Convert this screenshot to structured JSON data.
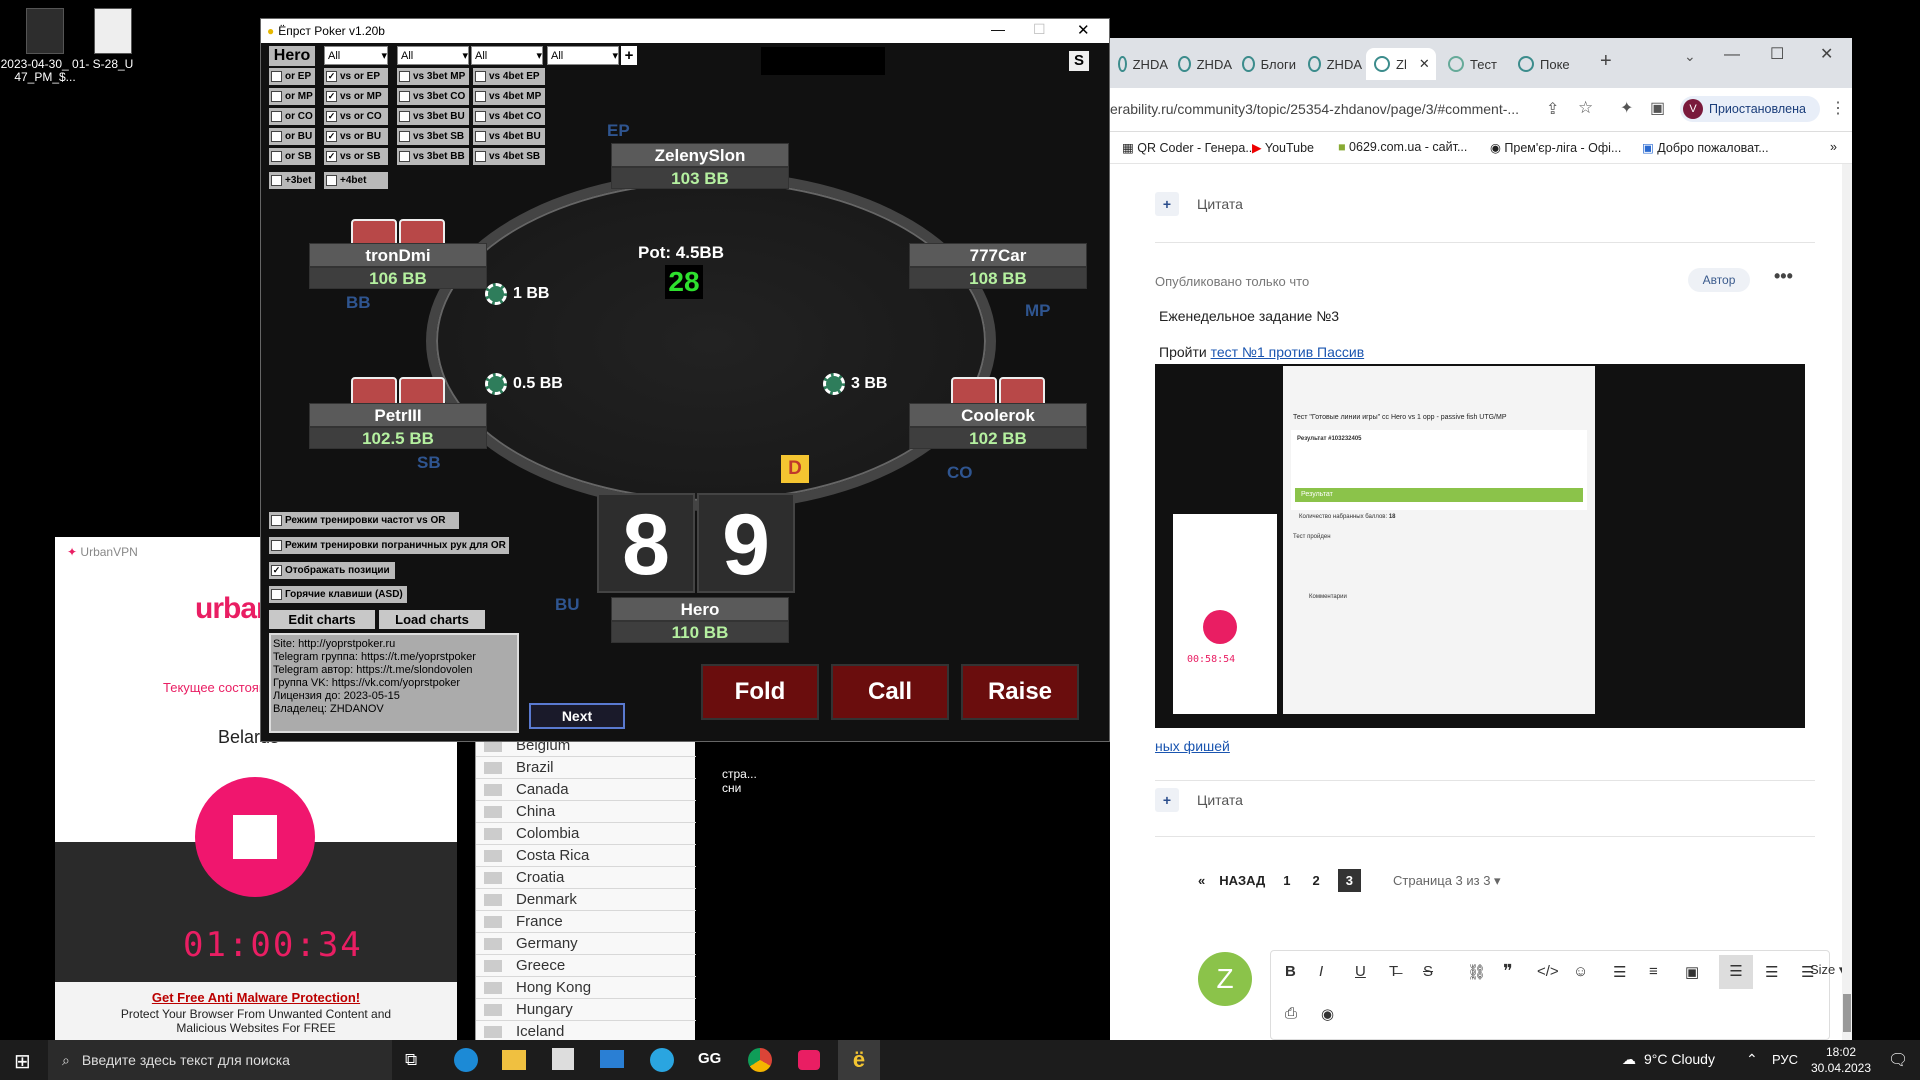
{
  "desktop": {
    "icons": [
      {
        "label": "2023-04-30_ 01-47_PM_$..."
      },
      {
        "label": "S-28_U"
      }
    ],
    "mid_text": "стра...\nсни"
  },
  "poker": {
    "title": "Ёпрст Poker v1.20b",
    "hero_label": "Hero",
    "selects": [
      "All",
      "All",
      "All",
      "All"
    ],
    "add_label": "+",
    "s_label": "S",
    "col1": [
      "or EP",
      "or MP",
      "or CO",
      "or BU",
      "or SB"
    ],
    "col2": [
      "vs or EP",
      "vs or MP",
      "vs or CO",
      "vs or BU",
      "vs or SB"
    ],
    "col3": [
      "vs 3bet MP",
      "vs 3bet CO",
      "vs 3bet BU",
      "vs 3bet SB",
      "vs 3bet BB"
    ],
    "col4": [
      "vs 4bet EP",
      "vs 4bet MP",
      "vs 4bet CO",
      "vs 4bet BU",
      "vs 4bet SB"
    ],
    "extra": [
      "+3bet",
      "+4bet"
    ],
    "seats": {
      "ep": {
        "name": "ZelenySlon",
        "stack": "103 BB",
        "pos": "EP"
      },
      "bb": {
        "name": "tronDmi",
        "stack": "106 BB",
        "pos": "BB"
      },
      "mp": {
        "name": "777Car",
        "stack": "108 BB",
        "pos": "MP"
      },
      "sb": {
        "name": "PetrIII",
        "stack": "102.5 BB",
        "pos": "SB"
      },
      "co": {
        "name": "Coolerok",
        "stack": "102 BB",
        "pos": "CO"
      },
      "hero": {
        "name": "Hero",
        "stack": "110 BB",
        "pos": "BU"
      }
    },
    "pot": "Pot: 4.5BB",
    "timer": "28",
    "bets": {
      "bb": "1 BB",
      "sb": "0.5 BB",
      "co": "3 BB"
    },
    "dealer": "D",
    "hero_cards": [
      "8",
      "9"
    ],
    "options": [
      "Режим тренировки частот vs OR",
      "Режим тренировки пограничных рук для OR",
      "Отображать позиции",
      "Горячие клавиши (ASD)"
    ],
    "edit_charts": "Edit charts",
    "load_charts": "Load charts",
    "info_lines": [
      "Site: http://yoprstpoker.ru",
      "Telegram группа: https://t.me/yoprstpoker",
      "Telegram автор: https://t.me/slondovolen",
      "Группа VK: https://vk.com/yoprstpoker",
      "Лицензия до: 2023-05-15",
      "Владелец: ZHDANOV"
    ],
    "next": "Next",
    "actions": [
      "Fold",
      "Call",
      "Raise"
    ]
  },
  "browser": {
    "tabs": [
      "ZHDA",
      "ZHDA",
      "Блоги",
      "ZHDA",
      "Zl",
      "Тест",
      "Поке"
    ],
    "url": "erability.ru/community3/topic/25354-zhdanov/page/3/#comment-...",
    "profile_status": "Приостановлена",
    "profile_initial": "V",
    "bookmarks": [
      "QR Coder - Генера...",
      "YouTube",
      "0629.com.ua - сайт...",
      "Прем'єр-ліга - Офі...",
      "Добро пожаловат..."
    ],
    "quote_label": "Цитата",
    "post_meta": "Опубликовано только что",
    "author_badge": "Автор",
    "post_title": "Еженедельное задание №3",
    "post_prefix": "Пройти ",
    "post_link": "тест №1 против Пассив",
    "post_link_tail": "ных фишей",
    "pagination": {
      "back": "НАЗАД",
      "pages": [
        "1",
        "2",
        "3"
      ],
      "info": "Страница 3 из 3"
    },
    "editor_avatar": "Z",
    "size_label": "Size",
    "embedded": {
      "heading": "Тест \"Готовые линии игры\" cc Hero vs 1 opp - passive fish UTG/MP",
      "result": "Результат #103232405",
      "result_bar": "Результат",
      "count_label": "Количество набранных баллов:",
      "count": "18",
      "passed": "Тест пройден",
      "comments": "Комментарии",
      "timer": "00:58:54"
    }
  },
  "vpn": {
    "brand": "UrbanVPN",
    "logo": "urban",
    "status": "Текущее состоян",
    "country": "Belarus",
    "timer": "01:00:34",
    "ad_title": "Get Free Anti Malware Protection!",
    "ad_text": "Protect Your Browser From Unwanted Content and Malicious Websites For FREE"
  },
  "countries": [
    "Belgium",
    "Brazil",
    "Canada",
    "China",
    "Colombia",
    "Costa Rica",
    "Croatia",
    "Denmark",
    "France",
    "Germany",
    "Greece",
    "Hong Kong",
    "Hungary",
    "Iceland"
  ],
  "taskbar": {
    "search": "Введите здесь текст для поиска",
    "weather": "9°C  Cloudy",
    "lang": "РУС",
    "time": "18:02",
    "date": "30.04.2023"
  }
}
